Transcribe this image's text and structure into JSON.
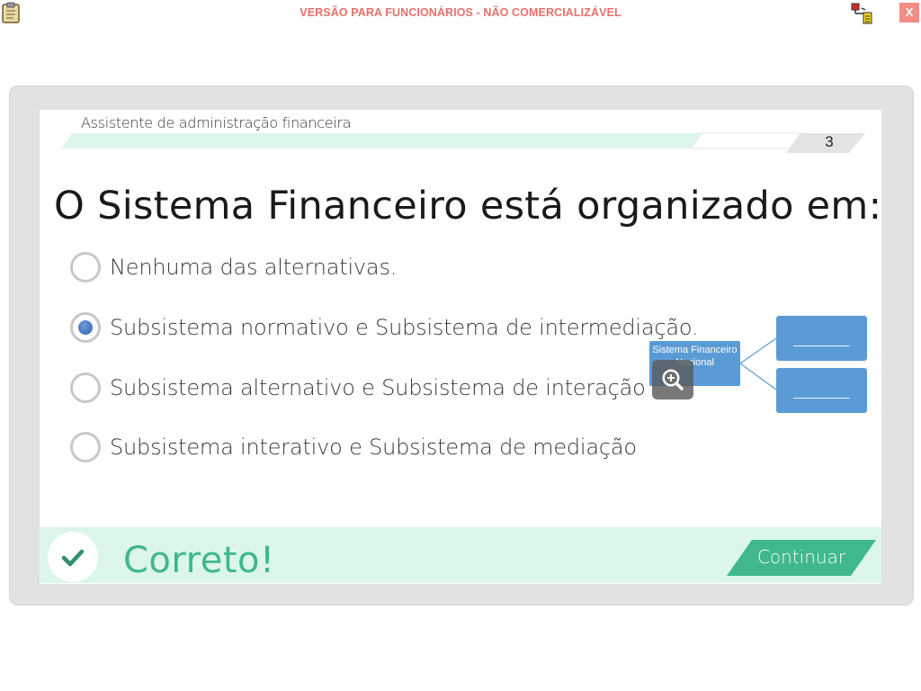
{
  "topbar": {
    "banner": "VERSÃO PARA FUNCIONÁRIOS - NÃO COMERCIALIZÁVEL",
    "close_label": "X"
  },
  "header": {
    "course_title": "Assistente de administração financeira",
    "page_number": "3"
  },
  "question": {
    "text": "O Sistema Financeiro está organizado em:",
    "options": [
      {
        "label": "Nenhuma das alternativas.",
        "selected": false
      },
      {
        "label": "Subsistema normativo e Subsistema de intermediação.",
        "selected": true
      },
      {
        "label": "Subsistema alternativo e Subsistema de interação",
        "selected": false
      },
      {
        "label": "Subsistema interativo e Subsistema de mediação",
        "selected": false
      }
    ]
  },
  "diagram": {
    "root_label": "Sistema Financeiro Nacional",
    "child_1": "________",
    "child_2": "________"
  },
  "feedback": {
    "text": "Correto!",
    "continue_label": "Continuar"
  },
  "colors": {
    "banner": "#e8706a",
    "close": "#f28c86",
    "accent_green": "#3fb88a",
    "feedback_bg": "#dcf6ea",
    "radio_selected": "#2f65b4",
    "diagram_box": "#5b9bd5"
  }
}
